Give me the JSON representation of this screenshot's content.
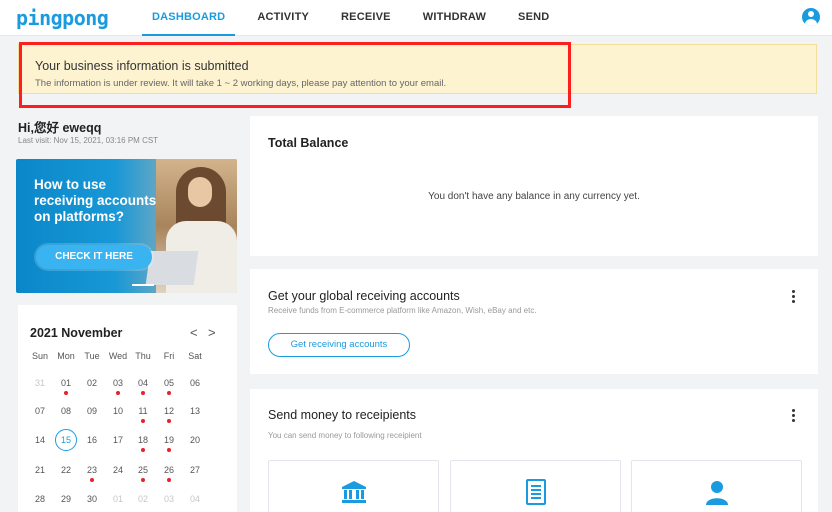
{
  "nav": {
    "logo": "pingpong",
    "items": [
      "DASHBOARD",
      "ACTIVITY",
      "RECEIVE",
      "WITHDRAW",
      "SEND"
    ],
    "active": "DASHBOARD"
  },
  "alert": {
    "title": "Your business information is submitted",
    "description": "The information is under review. It will take 1 ~ 2 working days,  please pay attention to your email."
  },
  "user": {
    "greeting": "Hi,您好 eweqq",
    "last_visit": "Last visit: Nov 15, 2021, 03:16 PM CST"
  },
  "promo": {
    "text": "How to use receiving accounts on platforms?",
    "button": "CHECK IT HERE"
  },
  "calendar": {
    "title": "2021 November",
    "prev": "<",
    "next": ">",
    "weekdays": [
      "Sun",
      "Mon",
      "Tue",
      "Wed",
      "Thu",
      "Fri",
      "Sat"
    ],
    "weeks": [
      [
        "31",
        "01",
        "02",
        "03",
        "04",
        "05",
        "06"
      ],
      [
        "07",
        "08",
        "09",
        "10",
        "11",
        "12",
        "13"
      ],
      [
        "14",
        "15",
        "16",
        "17",
        "18",
        "19",
        "20"
      ],
      [
        "21",
        "22",
        "23",
        "24",
        "25",
        "26",
        "27"
      ],
      [
        "28",
        "29",
        "30",
        "01",
        "02",
        "03",
        "04"
      ]
    ],
    "today": "15",
    "event_days": [
      "01",
      "03",
      "04",
      "05",
      "11",
      "12",
      "18",
      "19",
      "23",
      "25",
      "26"
    ]
  },
  "balance": {
    "title": "Total Balance",
    "empty": "You don't have any balance in any currency yet."
  },
  "accounts": {
    "title": "Get your global receiving accounts",
    "subtitle": "Receive funds from E-commerce platform like Amazon, Wish, eBay and etc.",
    "button": "Get receiving accounts"
  },
  "send": {
    "title": "Send money to receipients",
    "subtitle": "You can send money to following receipient",
    "recipients": [
      "bank-icon",
      "document-icon",
      "user-icon"
    ]
  },
  "colors": {
    "brand": "#1a9be0",
    "alert_bg": "#fdf3d1",
    "highlight": "#ff1e1e",
    "event_dot": "#e8202a"
  }
}
